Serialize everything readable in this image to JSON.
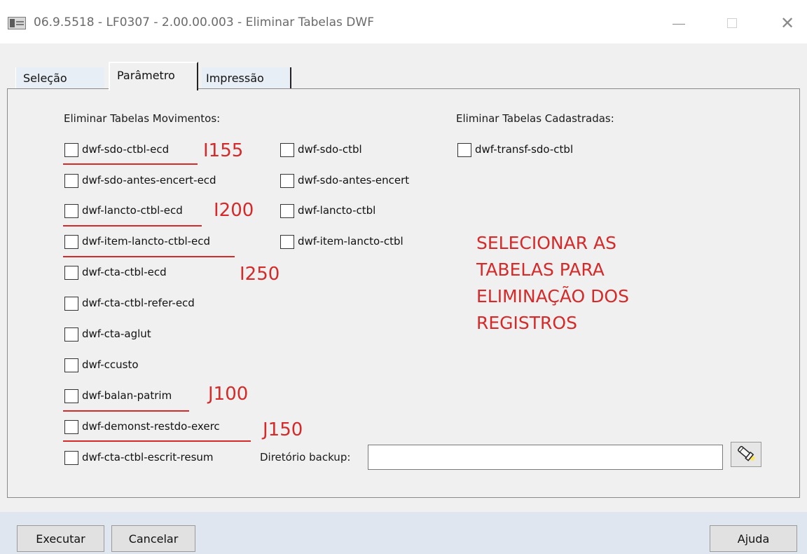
{
  "window": {
    "title": "06.9.5518 - LF0307 - 2.00.00.003 - Eliminar Tabelas DWF",
    "close_glyph": "✕"
  },
  "tabs": [
    {
      "label": "Seleção",
      "selected": false
    },
    {
      "label": "Parâmetro",
      "selected": true
    },
    {
      "label": "Impressão",
      "selected": false
    }
  ],
  "movimentos": {
    "heading": "Eliminar Tabelas Movimentos:",
    "col1": [
      {
        "label": "dwf-sdo-ctbl-ecd",
        "checked": false
      },
      {
        "label": "dwf-sdo-antes-encert-ecd",
        "checked": false
      },
      {
        "label": "dwf-lancto-ctbl-ecd",
        "checked": false
      },
      {
        "label": "dwf-item-lancto-ctbl-ecd",
        "checked": false
      },
      {
        "label": "dwf-cta-ctbl-ecd",
        "checked": false
      },
      {
        "label": "dwf-cta-ctbl-refer-ecd",
        "checked": false
      },
      {
        "label": "dwf-cta-aglut",
        "checked": false
      },
      {
        "label": "dwf-ccusto",
        "checked": false
      },
      {
        "label": "dwf-balan-patrim",
        "checked": false
      },
      {
        "label": "dwf-demonst-restdo-exerc",
        "checked": false
      },
      {
        "label": "dwf-cta-ctbl-escrit-resum",
        "checked": false
      }
    ],
    "col2": [
      {
        "label": "dwf-sdo-ctbl",
        "checked": false
      },
      {
        "label": "dwf-sdo-antes-encert",
        "checked": false
      },
      {
        "label": "dwf-lancto-ctbl",
        "checked": false
      },
      {
        "label": "dwf-item-lancto-ctbl",
        "checked": false
      }
    ]
  },
  "cadastradas": {
    "heading": "Eliminar Tabelas Cadastradas:",
    "items": [
      {
        "label": "dwf-transf-sdo-ctbl",
        "checked": false
      }
    ]
  },
  "backup": {
    "label": "Diretório backup:",
    "value": ""
  },
  "annotations": {
    "i155": "I155",
    "i200": "I200",
    "i250": "I250",
    "j100": "J100",
    "j150": "J150",
    "note": "SELECIONAR AS\nTABELAS PARA\nELIMINAÇÃO DOS\nREGISTROS",
    "color": "#d42a2a"
  },
  "buttons": {
    "executar": "Executar",
    "cancelar": "Cancelar",
    "ajuda": "Ajuda"
  },
  "icons": {
    "browse": "flashlight-icon"
  }
}
